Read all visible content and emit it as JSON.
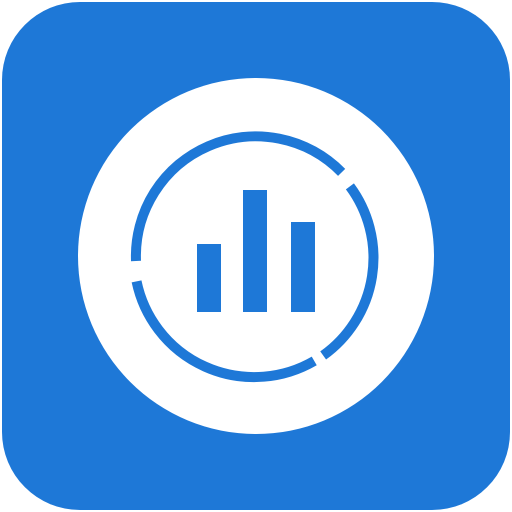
{
  "app_icon": {
    "icon_name": "analytics-chart-icon",
    "background_color": "#1E78D7",
    "badge_color": "#FFFFFF",
    "glyph_color": "#1E78D7"
  }
}
